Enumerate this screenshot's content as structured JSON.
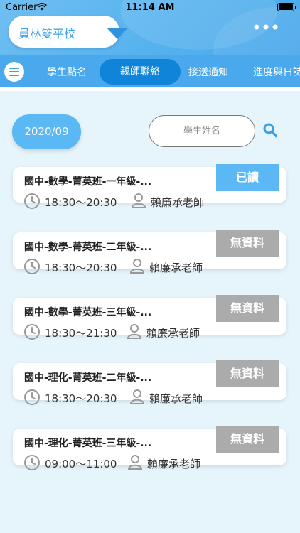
{
  "status_bar": {
    "carrier": "Carrier",
    "time": "11:14 AM"
  },
  "header": {
    "school": "員林雙平校"
  },
  "tabs": [
    {
      "label": "學生點名",
      "active": false
    },
    {
      "label": "親師聯絡",
      "active": true
    },
    {
      "label": "接送通知",
      "active": false
    },
    {
      "label": "進度與日誌",
      "active": false
    }
  ],
  "filters": {
    "date": "2020/09",
    "search_placeholder": "學生姓名"
  },
  "cards": [
    {
      "title": "國中-數學-菁英班-一年級-...",
      "time": "18:30～20:30",
      "teacher": "賴廉承老師",
      "badge": "已讀"
    },
    {
      "title": "國中-數學-菁英班-二年級-...",
      "time": "18:30～20:30",
      "teacher": "賴廉承老師",
      "badge": "無資料"
    },
    {
      "title": "國中-數學-菁英班-三年級-...",
      "time": "18:30～21:30",
      "teacher": "賴廉承老師",
      "badge": "無資料"
    },
    {
      "title": "國中-理化-菁英班-二年級-...",
      "time": "18:30～20:30",
      "teacher": "賴廉承老師",
      "badge": "無資料"
    },
    {
      "title": "國中-理化-菁英班-三年級-...",
      "time": "09:00～11:00",
      "teacher": "賴廉承老師",
      "badge": "無資料"
    }
  ],
  "colors": {
    "primary": "#4aa9ec",
    "active_tab": "#0f84d9",
    "read_badge": "#5bb8f5",
    "empty_badge": "#ababab",
    "background": "#e6f4fb"
  }
}
